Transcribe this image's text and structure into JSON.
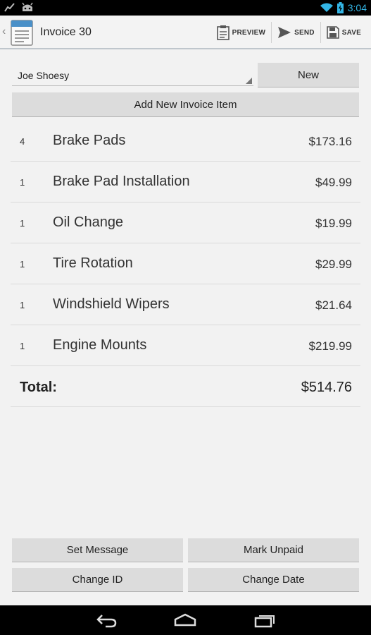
{
  "status_bar": {
    "time": "3:04",
    "left_icons": [
      "activity-graph-icon",
      "android-robot-icon"
    ],
    "right_icons": [
      "wifi-icon",
      "battery-charging-icon"
    ]
  },
  "action_bar": {
    "title": "Invoice 30",
    "actions": [
      {
        "label": "PREVIEW",
        "icon": "clipboard-icon"
      },
      {
        "label": "SEND",
        "icon": "send-icon"
      },
      {
        "label": "SAVE",
        "icon": "save-icon"
      }
    ]
  },
  "customer": {
    "name": "Joe Shoesy"
  },
  "buttons": {
    "new": "New",
    "add_item": "Add New Invoice Item",
    "set_message": "Set Message",
    "mark_unpaid": "Mark Unpaid",
    "change_id": "Change ID",
    "change_date": "Change Date"
  },
  "items": [
    {
      "qty": "4",
      "name": "Brake Pads",
      "price": "$173.16"
    },
    {
      "qty": "1",
      "name": "Brake Pad Installation",
      "price": "$49.99"
    },
    {
      "qty": "1",
      "name": "Oil Change",
      "price": "$19.99"
    },
    {
      "qty": "1",
      "name": "Tire Rotation",
      "price": "$29.99"
    },
    {
      "qty": "1",
      "name": "Windshield Wipers",
      "price": "$21.64"
    },
    {
      "qty": "1",
      "name": "Engine Mounts",
      "price": "$219.99"
    }
  ],
  "total": {
    "label": "Total:",
    "value": "$514.76"
  },
  "nav_bar": {
    "icons": [
      "back-icon",
      "home-icon",
      "recent-apps-icon"
    ]
  },
  "colors": {
    "accent": "#33b5e5",
    "button_bg": "#dcdcdc",
    "background": "#f2f2f2"
  }
}
